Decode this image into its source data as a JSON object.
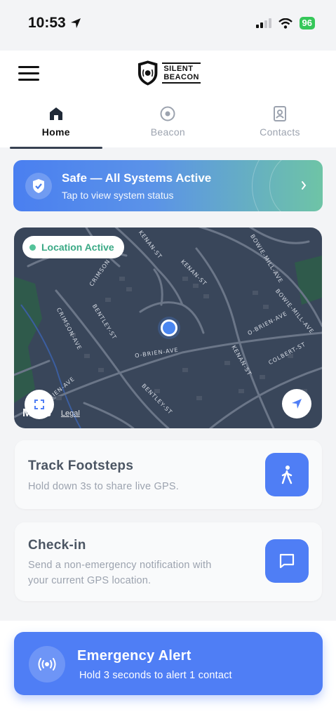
{
  "status_bar": {
    "time": "10:53",
    "battery": "96"
  },
  "header": {
    "logo_line1": "SILENT",
    "logo_line2": "BEACON",
    "tabs": [
      {
        "label": "Home",
        "icon": "home-icon",
        "active": true
      },
      {
        "label": "Beacon",
        "icon": "beacon-icon",
        "active": false
      },
      {
        "label": "Contacts",
        "icon": "contacts-icon",
        "active": false
      }
    ]
  },
  "status_banner": {
    "title": "Safe — All Systems Active",
    "subtitle": "Tap to view system status"
  },
  "map": {
    "location_pill": "Location Active",
    "streets": [
      "KENAN-ST",
      "KENAN-ST",
      "KENAN-ST",
      "CRIMSON",
      "BOWIE-MILL-AVE",
      "BOWIE-MILL-AVE",
      "CRIMSON-AVE",
      "BENTLEY-ST",
      "O-BRIEN-AVE",
      "O-BRIEN-AVE",
      "O-BRIEN-AVE",
      "COLBERT-ST",
      "BENTLEY-ST"
    ],
    "credit": "Maps",
    "legal": "Legal"
  },
  "cards": {
    "track": {
      "title": "Track Footsteps",
      "subtitle": "Hold down 3s to share live GPS."
    },
    "checkin": {
      "title": "Check-in",
      "subtitle_line1": "Send a non-emergency notification with",
      "subtitle_line2": "your current GPS location."
    }
  },
  "emergency": {
    "title": "Emergency Alert",
    "subtitle": "Hold 3 seconds to alert 1 contact"
  },
  "colors": {
    "accent": "#4f7ef5",
    "safe_green": "#3aa985",
    "map_bg": "#39465a"
  }
}
